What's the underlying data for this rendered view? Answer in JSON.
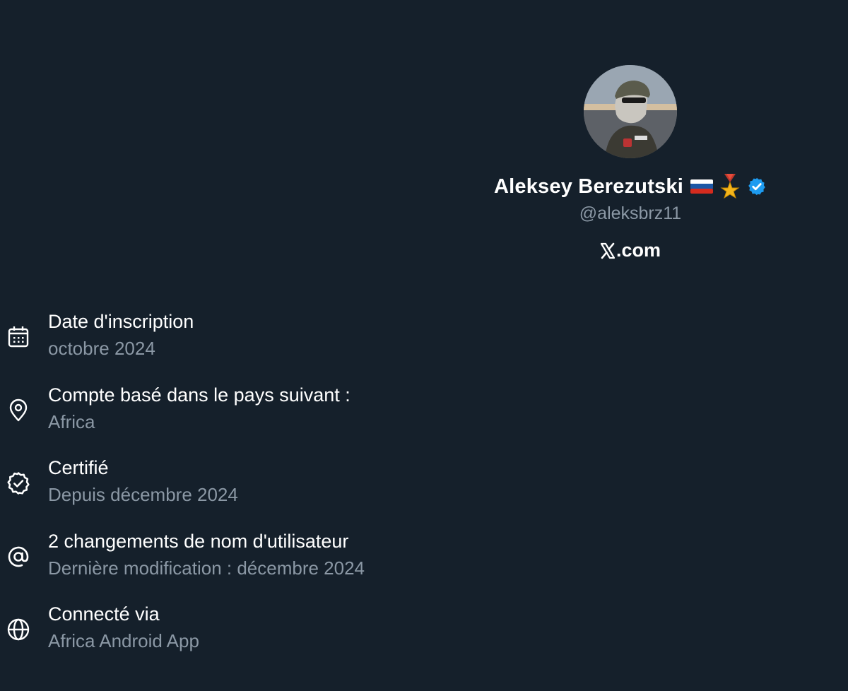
{
  "profile": {
    "display_name": "Aleksey Berezutski",
    "handle": "@aleksbrz11",
    "website_suffix": ".com",
    "badges": [
      "russian-flag-icon",
      "medal-icon",
      "verified-badge-icon"
    ],
    "verified_color": "#1d9bf0"
  },
  "info": [
    {
      "icon": "calendar-icon",
      "title": "Date d'inscription",
      "sub": "octobre 2024"
    },
    {
      "icon": "location-pin-icon",
      "title": "Compte basé dans le pays suivant :",
      "sub": "Africa"
    },
    {
      "icon": "verified-check-icon",
      "title": "Certifié",
      "sub": "Depuis décembre 2024"
    },
    {
      "icon": "at-sign-icon",
      "title": "2 changements de nom d'utilisateur",
      "sub": "Dernière modification : décembre 2024"
    },
    {
      "icon": "globe-icon",
      "title": "Connecté via",
      "sub": "Africa Android App"
    }
  ],
  "colors": {
    "background": "#15202b",
    "primary_text": "#ffffff",
    "secondary_text": "#8b98a5"
  }
}
